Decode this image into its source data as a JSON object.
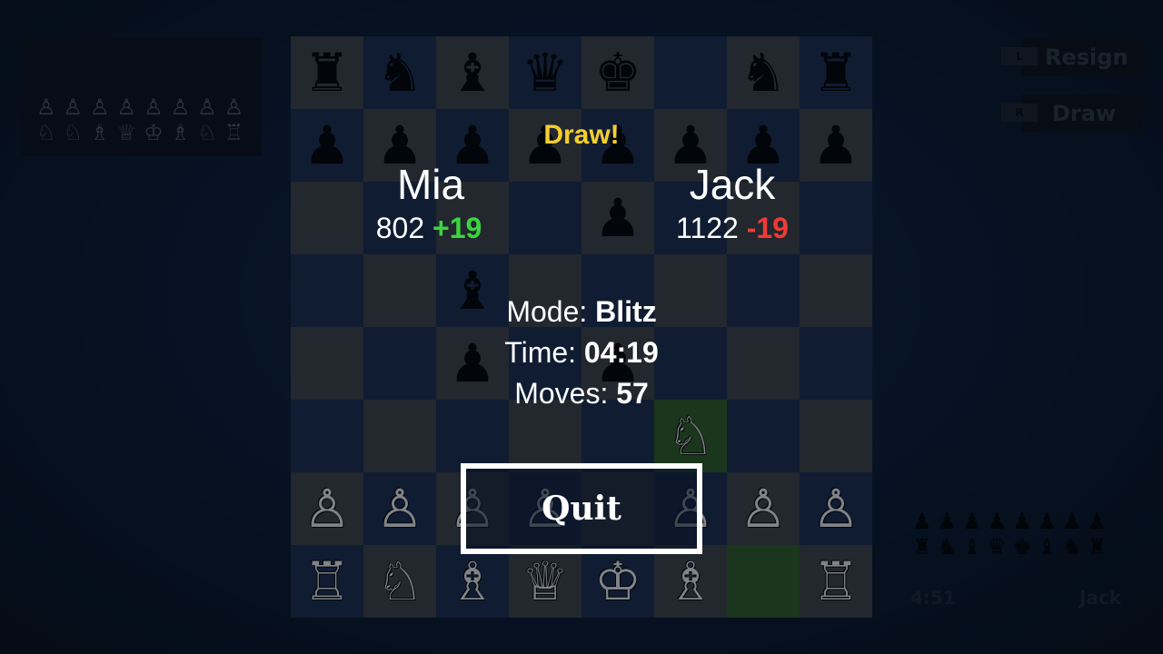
{
  "board": {
    "rows": [
      [
        "♜",
        "♞",
        "♝",
        "♛",
        "♚",
        "",
        "♞",
        "♜"
      ],
      [
        "♟",
        "♟",
        "♟",
        "♟",
        "♟",
        "♟",
        "♟",
        "♟"
      ],
      [
        "",
        "",
        "",
        "",
        "♟",
        "",
        "",
        ""
      ],
      [
        "",
        "",
        "♝",
        "",
        "",
        "",
        "",
        ""
      ],
      [
        "",
        "",
        "♟",
        "",
        "♟",
        "",
        "",
        ""
      ],
      [
        "",
        "",
        "",
        "",
        "",
        "♘",
        "",
        ""
      ],
      [
        "♙",
        "♙",
        "♙",
        "♙",
        "",
        "♙",
        "♙",
        "♙"
      ],
      [
        "♖",
        "♘",
        "♗",
        "♕",
        "♔",
        "♗",
        "",
        "♖"
      ]
    ],
    "highlighted": [
      "5-5",
      "7-6"
    ]
  },
  "side_controls": {
    "resign": {
      "key": "L",
      "label": "Resign"
    },
    "draw": {
      "key": "R",
      "label": "Draw"
    }
  },
  "captured": {
    "top_row1": [
      "♙",
      "♙",
      "♙",
      "♙",
      "♙",
      "♙",
      "♙",
      "♙"
    ],
    "top_row2": [
      "♘",
      "♘",
      "♗",
      "♕",
      "♔",
      "♗",
      "♘",
      "♖"
    ],
    "bottom_row1": [
      "♟",
      "♟",
      "♟",
      "♟",
      "♟",
      "♟",
      "♟",
      "♟"
    ],
    "bottom_row2": [
      "♜",
      "♞",
      "♝",
      "♛",
      "♚",
      "♝",
      "♞",
      "♜"
    ]
  },
  "bottom_panel": {
    "clock": "4:51",
    "name": "Jack"
  },
  "result": {
    "title": "Draw!",
    "left_player": {
      "name": "Mia",
      "rating": "802",
      "delta": "+19"
    },
    "right_player": {
      "name": "Jack",
      "rating": "1122",
      "delta": "-19"
    },
    "mode_label": "Mode:",
    "mode_value": "Blitz",
    "time_label": "Time:",
    "time_value": "04:19",
    "moves_label": "Moves:",
    "moves_value": "57",
    "quit_label": "Quit"
  },
  "colors": {
    "result_title": "#f3cf2f",
    "delta_positive": "#39d53f",
    "delta_negative": "#ef3b36",
    "light_square": "#3c3f44",
    "dark_square": "#1b2a4c",
    "highlight_square": "#2d5a23"
  }
}
